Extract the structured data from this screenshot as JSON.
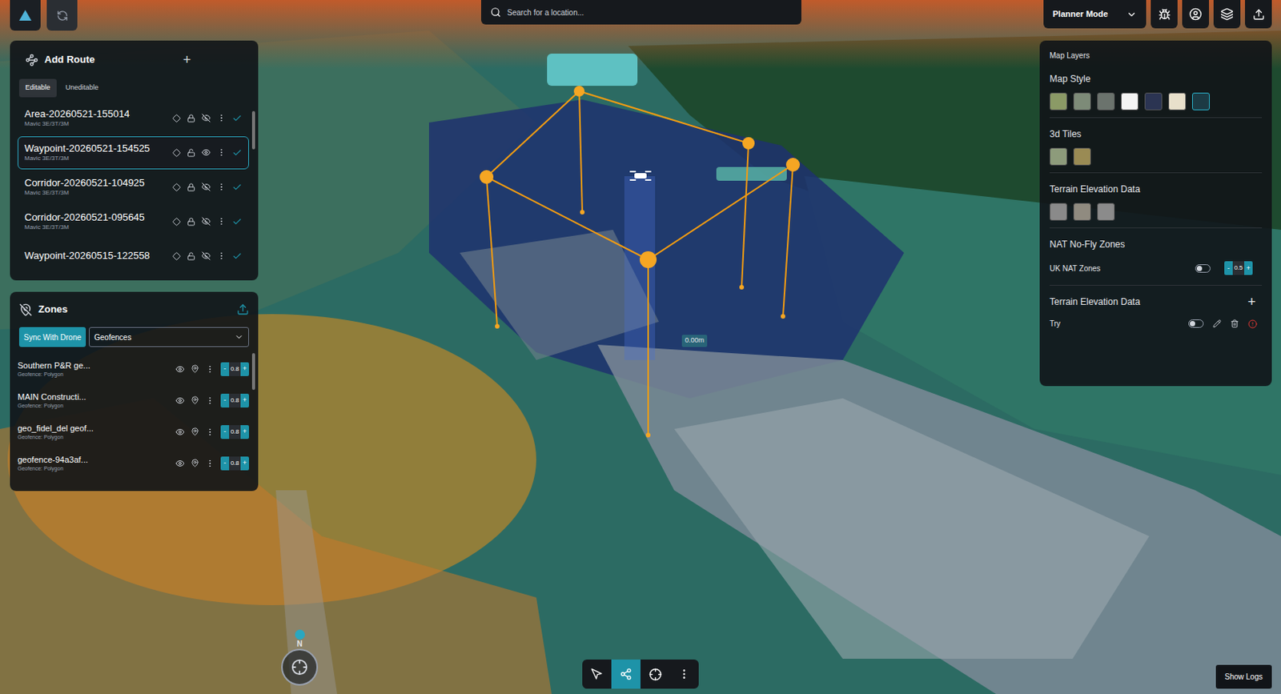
{
  "search": {
    "placeholder": "Search for a location..."
  },
  "mode_select": {
    "value": "Planner Mode"
  },
  "routes_panel": {
    "title": "Add Route",
    "add": "+",
    "tabs": [
      {
        "label": "Editable",
        "selected": true
      },
      {
        "label": "Uneditable",
        "selected": false
      }
    ],
    "routes": [
      {
        "name": "Area-20260521-155014",
        "drone": "Mavic 3E/3T/3M",
        "selected": false,
        "locked": true,
        "visible": false
      },
      {
        "name": "Waypoint-20260521-154525",
        "drone": "Mavic 3E/3T/3M",
        "selected": true,
        "locked": false,
        "visible": true
      },
      {
        "name": "Corridor-20260521-104925",
        "drone": "Mavic 3E/3T/3M",
        "selected": false,
        "locked": true,
        "visible": false
      },
      {
        "name": "Corridor-20260521-095645",
        "drone": "Mavic 3E/3T/3M",
        "selected": false,
        "locked": true,
        "visible": false
      },
      {
        "name": "Waypoint-20260515-122558",
        "selected": false,
        "locked": false,
        "visible": false
      }
    ]
  },
  "zones_panel": {
    "title": "Zones",
    "sync_button": "Sync With Drone",
    "filter": "Geofences",
    "zones": [
      {
        "name": "Southern P&R ge...",
        "type": "Geofence: Polygon",
        "opacity": "0.8",
        "visible": true
      },
      {
        "name": "MAIN Constructi...",
        "type": "Geofence: Polygon",
        "opacity": "0.8",
        "visible": true
      },
      {
        "name": "geo_fidel_del geof...",
        "type": "Geofence: Polygon",
        "opacity": "0.8",
        "visible": true
      },
      {
        "name": "geofence-94a3af...",
        "type": "Geofence: Polygon",
        "opacity": "0.8",
        "visible": true
      }
    ]
  },
  "stepper": {
    "minus": "-",
    "plus": "+"
  },
  "layers_panel": {
    "title": "Map Layers",
    "map_style": {
      "label": "Map Style",
      "swatches": [
        {
          "color": "#8b9a66",
          "selected": false
        },
        {
          "color": "#7d8b78",
          "selected": false
        },
        {
          "color": "#6b736d",
          "selected": false
        },
        {
          "color": "#f4f4f4",
          "selected": false
        },
        {
          "color": "#2b3452",
          "selected": false
        },
        {
          "color": "#e8e0cb",
          "selected": false
        },
        {
          "color": "#1c3a44",
          "selected": true
        }
      ]
    },
    "tiles": {
      "label": "3d Tiles",
      "swatches": [
        {
          "color": "#8d9b7b",
          "selected": false
        },
        {
          "color": "#9a8b54",
          "selected": false
        }
      ]
    },
    "terrain": {
      "label": "Terrain Elevation Data",
      "swatches": [
        {
          "color": "#8a8a8a",
          "selected": false
        },
        {
          "color": "#908b80",
          "selected": false
        },
        {
          "color": "#8b8b8b",
          "selected": false
        }
      ]
    },
    "nat": {
      "label": "NAT No-Fly Zones",
      "row": {
        "name": "UK NAT Zones",
        "on": false,
        "value": "0.5"
      }
    },
    "terrain_custom": {
      "label": "Terrain Elevation Data",
      "add": "+",
      "rows": [
        {
          "name": "Try",
          "on": false
        }
      ]
    }
  },
  "map": {
    "distance_label": "0.00m",
    "compass": "N"
  },
  "toolbar": [
    {
      "kind": "select",
      "selected": false
    },
    {
      "kind": "route",
      "selected": true
    },
    {
      "kind": "locate",
      "selected": false
    },
    {
      "kind": "more",
      "selected": false
    }
  ],
  "show_logs": "Show Logs"
}
